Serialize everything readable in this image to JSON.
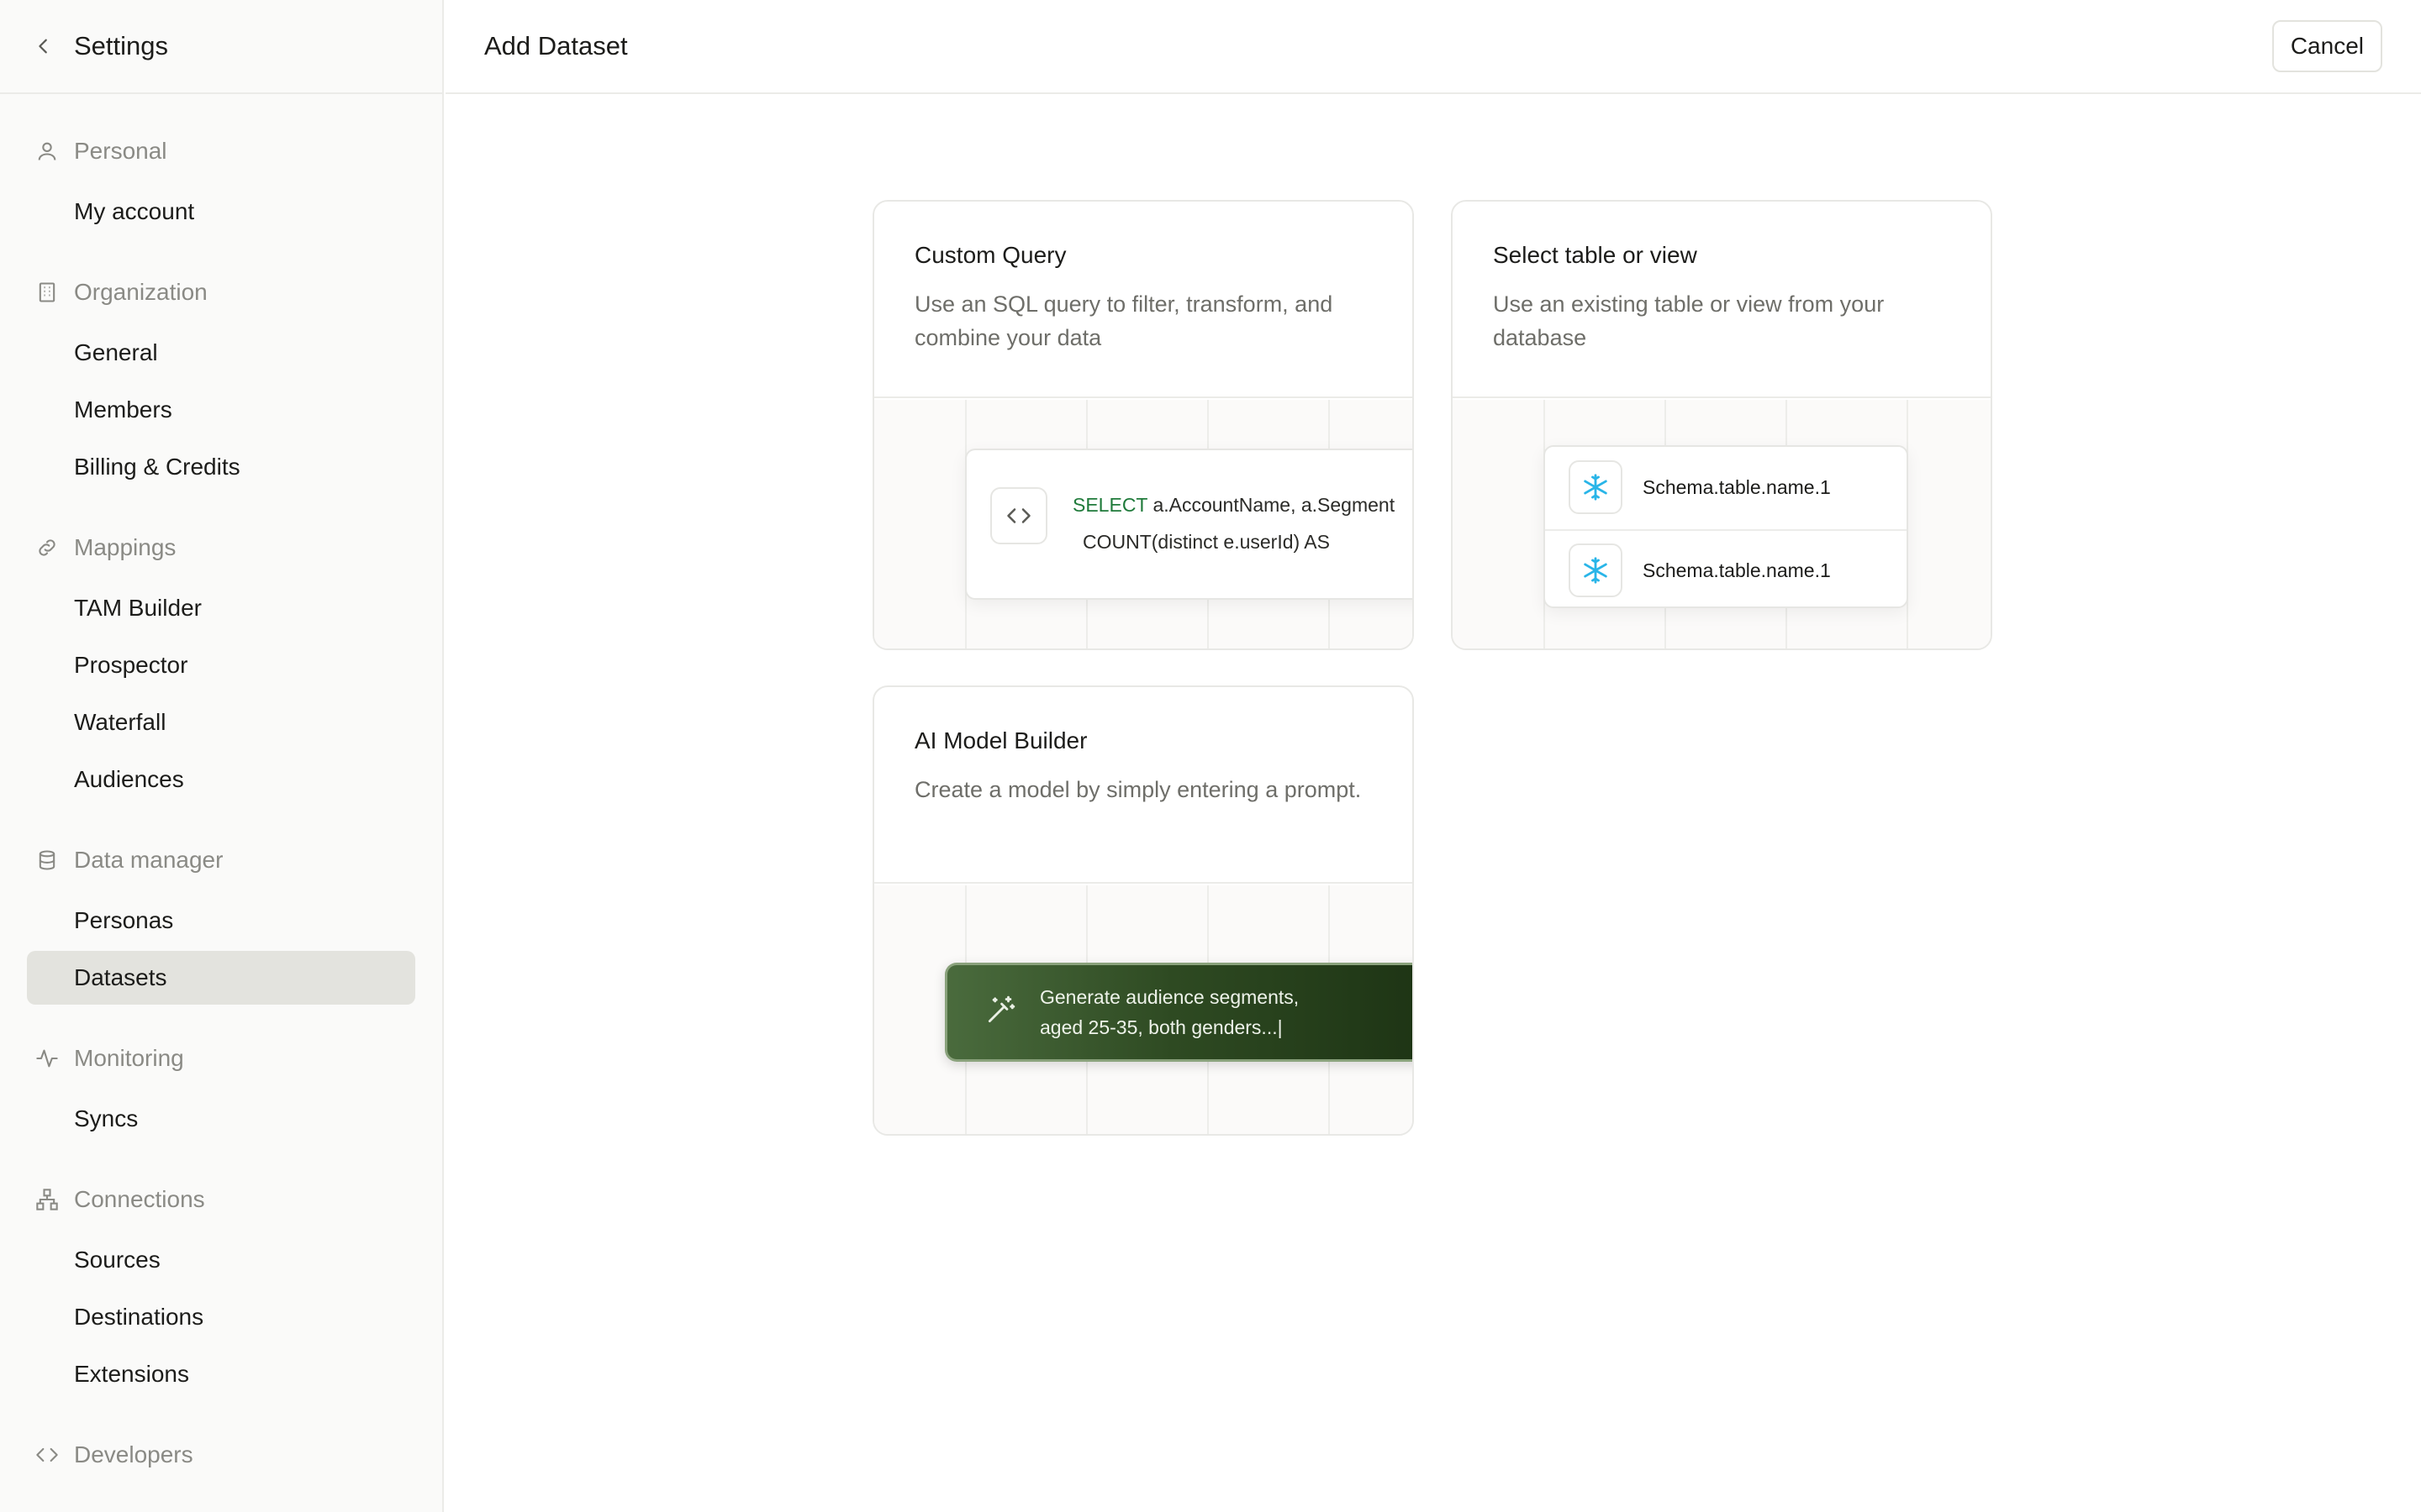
{
  "sidebar": {
    "title": "Settings",
    "groups": {
      "personal": {
        "label": "Personal",
        "items": [
          "My account"
        ]
      },
      "organization": {
        "label": "Organization",
        "items": [
          "General",
          "Members",
          "Billing & Credits"
        ]
      },
      "mappings": {
        "label": "Mappings",
        "items": [
          "TAM Builder",
          "Prospector",
          "Waterfall",
          "Audiences"
        ]
      },
      "data_manager": {
        "label": "Data manager",
        "items": [
          "Personas",
          "Datasets"
        ]
      },
      "monitoring": {
        "label": "Monitoring",
        "items": [
          "Syncs"
        ]
      },
      "connections": {
        "label": "Connections",
        "items": [
          "Sources",
          "Destinations",
          "Extensions"
        ]
      },
      "developers": {
        "label": "Developers"
      }
    },
    "active_item": "Datasets"
  },
  "header": {
    "title": "Add Dataset",
    "cancel_label": "Cancel"
  },
  "cards": {
    "custom_query": {
      "title": "Custom Query",
      "description": "Use an SQL query to filter, transform, and combine your data",
      "sql_keyword": "SELECT",
      "sql_line1": " a.AccountName, a.Segment",
      "sql_line2": "COUNT(distinct e.userId) AS"
    },
    "select_table": {
      "title": "Select table or view",
      "description": "Use an existing table or view from your database",
      "tables": [
        "Schema.table.name.1",
        "Schema.table.name.1"
      ]
    },
    "ai_model": {
      "title": "AI Model Builder",
      "description": "Create a model by simply entering a prompt.",
      "prompt_line1": "Generate audience segments,",
      "prompt_line2": "aged 25-35, both genders...|"
    }
  },
  "colors": {
    "active_bg": "#e3e3de",
    "sql_keyword": "#1f7a3a",
    "snowflake": "#29b5e8",
    "ai_gradient_dark": "#1c3213"
  }
}
